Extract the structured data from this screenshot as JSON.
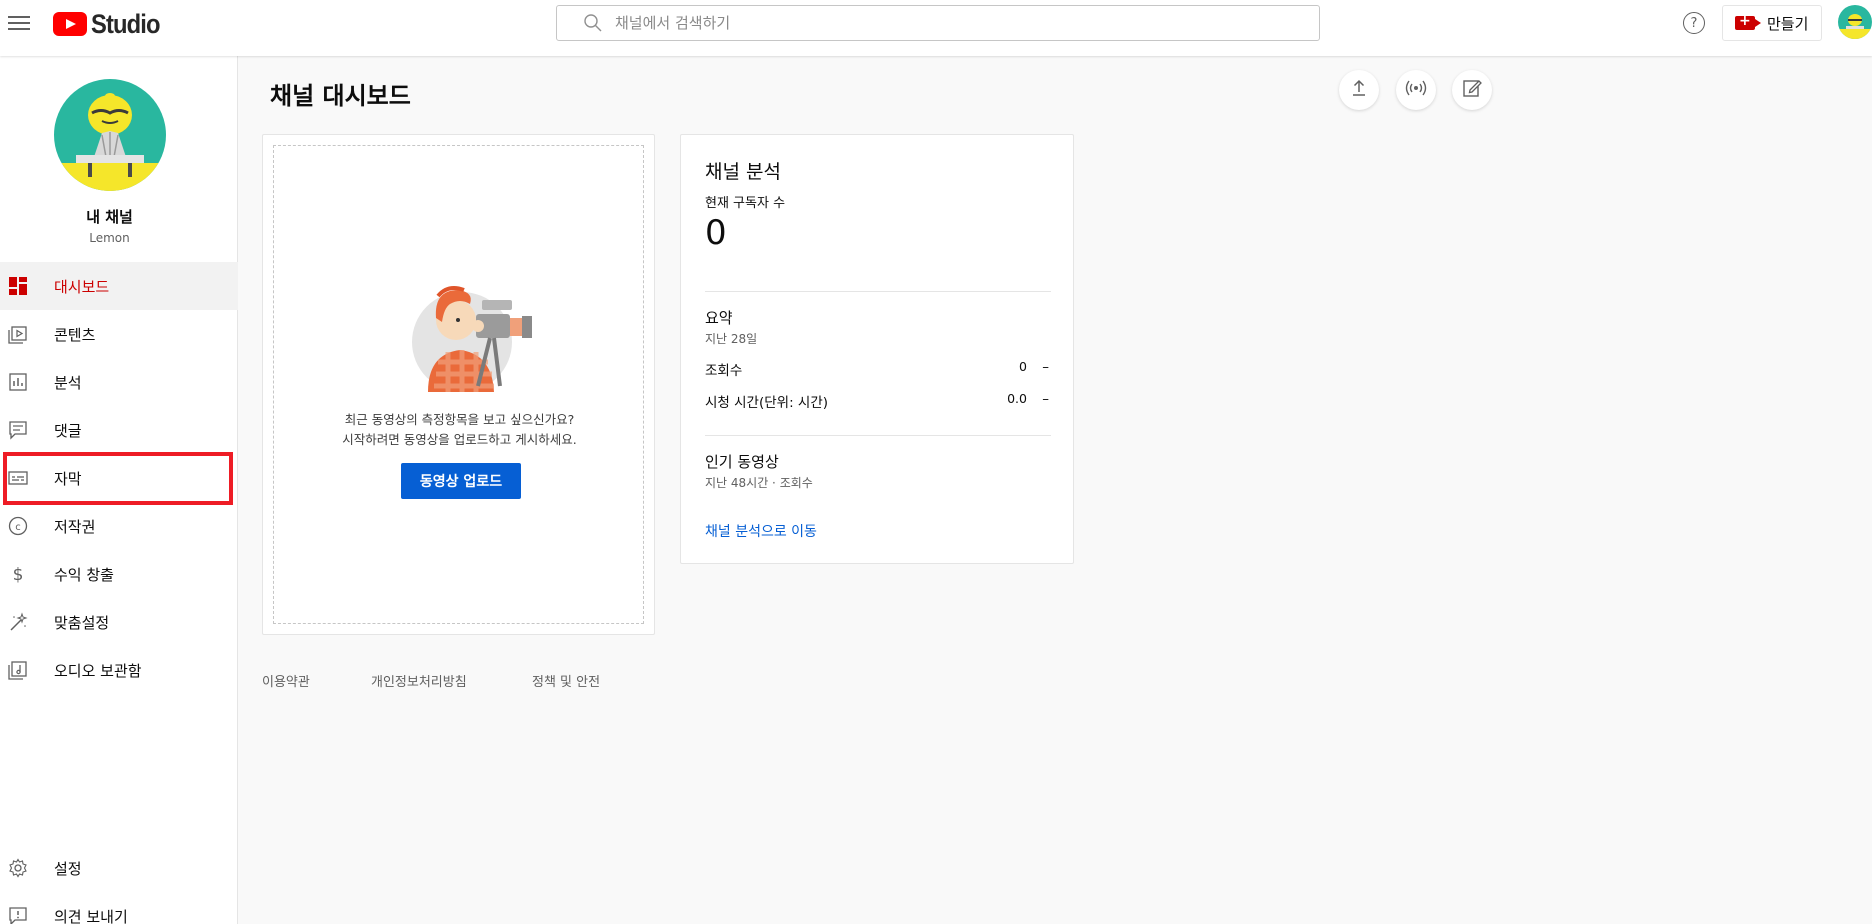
{
  "header": {
    "logo_text": "Studio",
    "search_placeholder": "채널에서 검색하기",
    "help_label": "?",
    "create_label": "만들기"
  },
  "sidebar": {
    "channel_name": "내 채널",
    "channel_handle": "Lemon",
    "items": [
      {
        "label": "대시보드",
        "icon": "dashboard-icon",
        "active": true
      },
      {
        "label": "콘텐츠",
        "icon": "content-icon"
      },
      {
        "label": "분석",
        "icon": "analytics-icon"
      },
      {
        "label": "댓글",
        "icon": "comments-icon"
      },
      {
        "label": "자막",
        "icon": "subtitles-icon"
      },
      {
        "label": "저작권",
        "icon": "copyright-icon"
      },
      {
        "label": "수익 창출",
        "icon": "dollar-icon"
      },
      {
        "label": "맞춤설정",
        "icon": "magic-wand-icon"
      },
      {
        "label": "오디오 보관함",
        "icon": "audio-library-icon"
      }
    ],
    "bottom_items": [
      {
        "label": "설정",
        "icon": "gear-icon"
      },
      {
        "label": "의견 보내기",
        "icon": "feedback-icon"
      }
    ],
    "highlight_color": "#ee1c25"
  },
  "main": {
    "title": "채널 대시보드",
    "upload_card": {
      "line1": "최근 동영상의 측정항목을 보고 싶으신가요?",
      "line2": "시작하려면 동영상을 업로드하고 게시하세요.",
      "button": "동영상 업로드"
    },
    "analytics": {
      "title": "채널 분석",
      "subscribers_label": "현재 구독자 수",
      "subscribers_value": "0",
      "summary_title": "요약",
      "summary_period": "지난 28일",
      "rows": [
        {
          "label": "조회수",
          "value": "0",
          "trend": "–"
        },
        {
          "label": "시청 시간(단위: 시간)",
          "value": "0.0",
          "trend": "–"
        }
      ],
      "popular_title": "인기 동영상",
      "popular_caption": "지난 48시간 · 조회수",
      "link": "채널 분석으로 이동"
    },
    "footer": [
      "이용약관",
      "개인정보처리방침",
      "정책 및 안전"
    ]
  },
  "colors": {
    "accent": "#cc0000",
    "link": "#065fd4",
    "avatar_bg": "#29b79f"
  }
}
